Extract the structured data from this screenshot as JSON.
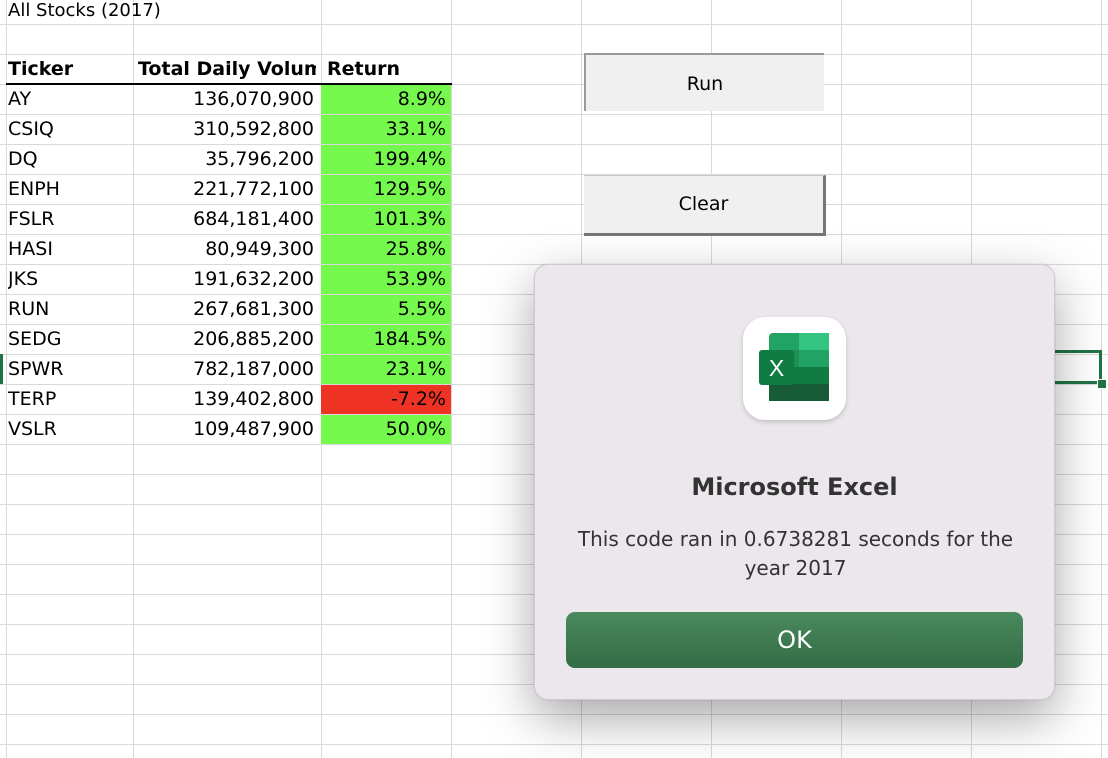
{
  "sheet": {
    "title": "All Stocks (2017)",
    "headers": {
      "ticker": "Ticker",
      "volume": "Total Daily Volume",
      "return": "Return"
    },
    "rows": [
      {
        "ticker": "AY",
        "volume": "136,070,900",
        "return": "8.9%",
        "positive": true
      },
      {
        "ticker": "CSIQ",
        "volume": "310,592,800",
        "return": "33.1%",
        "positive": true
      },
      {
        "ticker": "DQ",
        "volume": "35,796,200",
        "return": "199.4%",
        "positive": true
      },
      {
        "ticker": "ENPH",
        "volume": "221,772,100",
        "return": "129.5%",
        "positive": true
      },
      {
        "ticker": "FSLR",
        "volume": "684,181,400",
        "return": "101.3%",
        "positive": true
      },
      {
        "ticker": "HASI",
        "volume": "80,949,300",
        "return": "25.8%",
        "positive": true
      },
      {
        "ticker": "JKS",
        "volume": "191,632,200",
        "return": "53.9%",
        "positive": true
      },
      {
        "ticker": "RUN",
        "volume": "267,681,300",
        "return": "5.5%",
        "positive": true
      },
      {
        "ticker": "SEDG",
        "volume": "206,885,200",
        "return": "184.5%",
        "positive": true
      },
      {
        "ticker": "SPWR",
        "volume": "782,187,000",
        "return": "23.1%",
        "positive": true
      },
      {
        "ticker": "TERP",
        "volume": "139,402,800",
        "return": "-7.2%",
        "positive": false
      },
      {
        "ticker": "VSLR",
        "volume": "109,487,900",
        "return": "50.0%",
        "positive": true
      }
    ],
    "colors": {
      "positive": "#75f94c",
      "negative": "#ee3324",
      "gridline": "#d9d9d9",
      "selection": "#217346"
    }
  },
  "buttons": {
    "run_label": "Run",
    "clear_label": "Clear"
  },
  "dialog": {
    "icon": "microsoft-excel-icon",
    "icon_letter": "X",
    "title": "Microsoft Excel",
    "message": "This code ran in 0.6738281 seconds for the year 2017",
    "ok_label": "OK",
    "ok_color": "#3e7a51"
  }
}
